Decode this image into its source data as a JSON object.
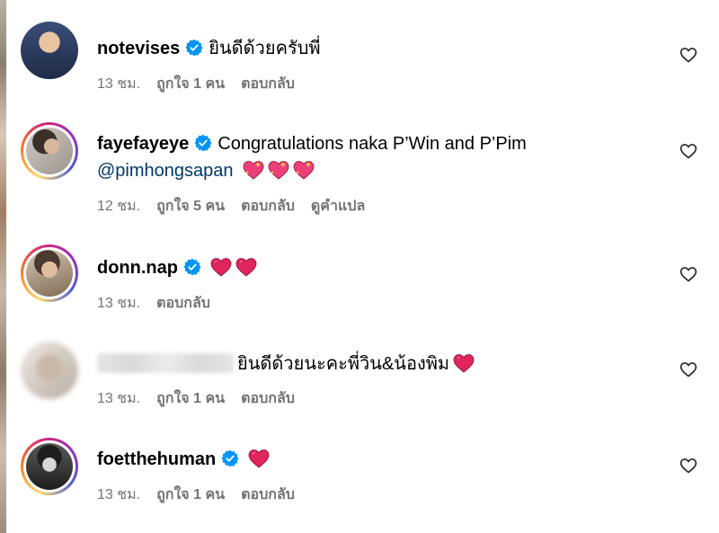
{
  "comments": [
    {
      "username": "notevises",
      "text": "ยินดีด้วยครับพี่",
      "time": "13 ชม.",
      "likes": "ถูกใจ 1 คน",
      "reply": "ตอบกลับ"
    },
    {
      "username": "fayefayeye",
      "text": "Congratulations naka P’Win and P’Pim",
      "mention": "@pimhongsapan",
      "time": "12 ชม.",
      "likes": "ถูกใจ 5 คน",
      "reply": "ตอบกลับ",
      "translate": "ดูคำแปล"
    },
    {
      "username": "donn.nap",
      "time": "13 ชม.",
      "reply": "ตอบกลับ"
    },
    {
      "text": "ยินดีด้วยนะคะพี่วิน&น้องพิม",
      "time": "13 ชม.",
      "likes": "ถูกใจ 1 คน",
      "reply": "ตอบกลับ"
    },
    {
      "username": "foetthehuman",
      "time": "13 ชม.",
      "likes": "ถูกใจ 1 คน",
      "reply": "ตอบกลับ"
    }
  ],
  "colors": {
    "verified": "#0095f6",
    "heart": "#e0245e",
    "muted": "#737373",
    "mention": "#00376b"
  },
  "icons": [
    "verified-badge-icon",
    "red-heart-emoji",
    "sparkling-heart-emoji",
    "heart-outline-icon"
  ]
}
